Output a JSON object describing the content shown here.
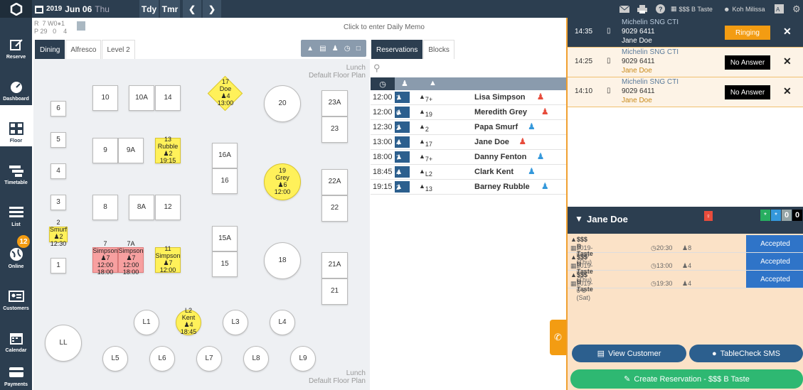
{
  "topbar": {
    "year": "2019",
    "date": "Jun 06",
    "weekday": "Thu",
    "today": "Tdy",
    "tomorrow": "Tmr",
    "shop": "$$$ B Taste",
    "user": "Koh Milissa"
  },
  "counts": {
    "r_label": "R",
    "r1": "7",
    "r2": "W",
    "r3": "0",
    "r4": "1",
    "p_label": "P",
    "p1": "29",
    "p2": "0",
    "p3": "4"
  },
  "memo": "Click to enter Daily Memo",
  "floor_tabs": [
    "Dining",
    "Alfresco",
    "Level 2"
  ],
  "floor_label": {
    "service": "Lunch",
    "plan": "Default Floor Plan"
  },
  "tables": {
    "t10": "10",
    "t10a": "10A",
    "t14": "14",
    "t20": "20",
    "t23a": "23A",
    "t23": "23",
    "t6": "6",
    "t5": "5",
    "t4": "4",
    "t3": "3",
    "t1": "1",
    "t9": "9",
    "t9a": "9A",
    "t16a": "16A",
    "t16": "16",
    "t22a": "22A",
    "t22": "22",
    "t8": "8",
    "t8a": "8A",
    "t12": "12",
    "t15a": "15A",
    "t15": "15",
    "t18": "18",
    "t21a": "21A",
    "t21": "21",
    "l1": "L1",
    "l3": "L3",
    "l4": "L4",
    "ll": "LL",
    "l5": "L5",
    "l6": "L6",
    "l7": "L7",
    "l8": "L8",
    "l9": "L9"
  },
  "booked": {
    "t17": {
      "num": "17",
      "name": "Doe",
      "pax": "4",
      "time": "13:00"
    },
    "t13": {
      "num": "13",
      "name": "Rubble",
      "pax": "2",
      "time": "19:15"
    },
    "t19": {
      "num": "19",
      "name": "Grey",
      "pax": "6",
      "time": "12:00"
    },
    "t2": {
      "num": "2",
      "name": "Smurf",
      "pax": "2",
      "time": "12:30"
    },
    "t7": {
      "num": "7",
      "name": "Simpson",
      "pax": "7",
      "time1": "12:00",
      "time2": "18:00"
    },
    "t7a": {
      "num": "7A",
      "name": "Simpson",
      "pax": "7",
      "time1": "12:00",
      "time2": "18:00"
    },
    "t11": {
      "num": "11",
      "name": "Simpson",
      "pax": "7",
      "time": "12:00"
    },
    "l2": {
      "num": "L2",
      "name": "Kent",
      "pax": "4",
      "time": "18:45"
    }
  },
  "res_tabs": [
    "Reservations",
    "Blocks"
  ],
  "reservations": [
    {
      "time": "12:00",
      "pax": "7",
      "table": "7+",
      "name": "Lisa Simpson",
      "g": "f"
    },
    {
      "time": "12:00",
      "pax": "6",
      "table": "19",
      "name": "Meredith Grey",
      "g": "f"
    },
    {
      "time": "12:30",
      "pax": "2",
      "table": "2",
      "name": "Papa Smurf",
      "g": "m"
    },
    {
      "time": "13:00",
      "pax": "4",
      "table": "17",
      "name": "Jane Doe",
      "g": "f"
    },
    {
      "time": "18:00",
      "pax": "7",
      "table": "7+",
      "name": "Danny Fenton",
      "g": "m"
    },
    {
      "time": "18:45",
      "pax": "4",
      "table": "L2",
      "name": "Clark Kent",
      "g": "m"
    },
    {
      "time": "19:15",
      "pax": "2",
      "table": "13",
      "name": "Barney Rubble",
      "g": "m"
    }
  ],
  "calls": [
    {
      "time": "14:35",
      "src": "Michelin SNG CTI",
      "phone": "9029 6411",
      "name": "Jane Doe",
      "status": "Ringing"
    },
    {
      "time": "14:25",
      "src": "Michelin SNG CTI",
      "phone": "9029 6411",
      "name": "Jane Doe",
      "status": "No Answer"
    },
    {
      "time": "14:10",
      "src": "Michelin SNG CTI",
      "phone": "9029 6411",
      "name": "Jane Doe",
      "status": "No Answer"
    }
  ],
  "customer": {
    "name": "Jane Doe",
    "c1": "*",
    "c2": "*",
    "c3": "0",
    "c4": "0"
  },
  "history": [
    {
      "shop": "$$$ B Taste",
      "date": "2019-5-30 (Thu)",
      "time": "20:30",
      "pax": "8",
      "status": "Accepted"
    },
    {
      "shop": "$$$ B Taste",
      "date": "2019-6-6 (Thu)",
      "time": "13:00",
      "pax": "4",
      "status": "Accepted"
    },
    {
      "shop": "$$$ B Taste",
      "date": "2019-6-8 (Sat)",
      "time": "19:30",
      "pax": "4",
      "status": "Accepted"
    }
  ],
  "buttons": {
    "view": "View Customer",
    "sms": "TableCheck SMS",
    "create": "Create Reservation - $$$ B Taste"
  },
  "nav": [
    "Reserve",
    "Dashboard",
    "Floor",
    "Timetable",
    "List",
    "Online",
    "Customers",
    "Calendar",
    "Payments"
  ],
  "online_badge": "12"
}
